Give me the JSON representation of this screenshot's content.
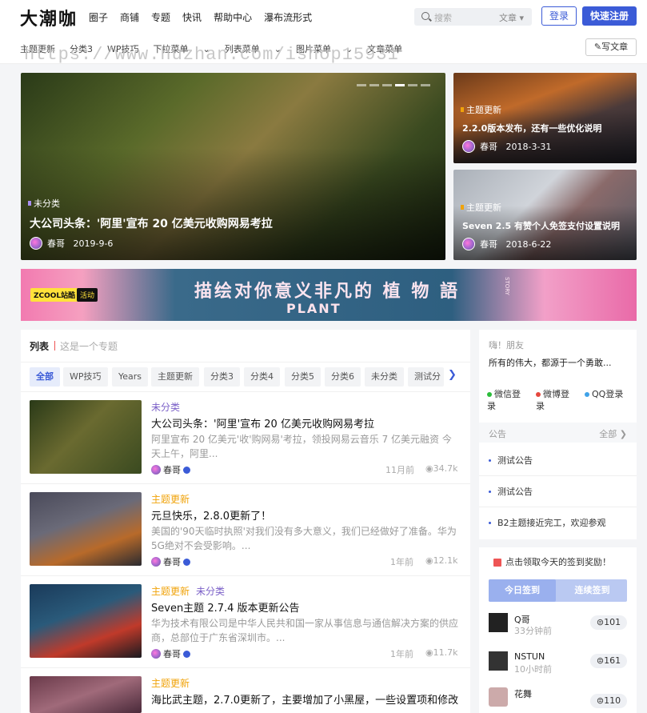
{
  "header": {
    "logo": "大潮咖",
    "nav": [
      "圈子",
      "商铺",
      "专题",
      "快讯",
      "帮助中心",
      "瀑布流形式"
    ],
    "search_placeholder": "搜索",
    "search_category": "文章",
    "login": "登录",
    "register": "快速注册",
    "subnav": [
      "主题更新",
      "分类3",
      "WP技巧",
      "下拉菜单",
      "列表菜单",
      "图片菜单",
      "文章菜单"
    ],
    "write": "写文章"
  },
  "watermark": "https://www.huzhan.com/ishop15931",
  "slides": [
    {
      "tag": "未分类",
      "title": "大公司头条：'阿里'宣布 20 亿美元收购网易考拉",
      "author": "春哥",
      "date": "2019-9-6"
    },
    {
      "tag": "主题更新",
      "title": "2.2.0版本发布，还有一些优化说明",
      "author": "春哥",
      "date": "2018-3-31"
    },
    {
      "tag": "主题更新",
      "title": "Seven 2.5 有赞个人免签支付设置说明",
      "author": "春哥",
      "date": "2018-6-22"
    }
  ],
  "banner": {
    "brand": "ZCOOL站酷",
    "label": "活动",
    "text": "描绘对你意义非凡的 植 物 語",
    "plant": "PLANT",
    "story": "STORY"
  },
  "list": {
    "title": "列表",
    "subtitle": "这是一个专题",
    "tabs": [
      "全部",
      "WP技巧",
      "Years",
      "主题更新",
      "分类3",
      "分类4",
      "分类5",
      "分类6",
      "未分类",
      "测试分"
    ],
    "items": [
      {
        "cats": [
          "未分类"
        ],
        "title": "大公司头条：'阿里'宣布 20 亿美元收购网易考拉",
        "desc": "阿里宣布 20 亿美元'收'购网易'考拉，领投网易云音乐 7 亿美元融资 今天上午，阿里...",
        "author": "春哥",
        "time": "11月前",
        "views": "34.7k"
      },
      {
        "cats": [
          "主题更新"
        ],
        "title": "元旦快乐，2.8.0更新了！",
        "desc": "美国的'90天临时执照'对我们没有多大意义，我们已经做好了准备。华为5G绝对不会受影响。...",
        "author": "春哥",
        "time": "1年前",
        "views": "12.1k"
      },
      {
        "cats": [
          "主题更新",
          "未分类"
        ],
        "title": "Seven主题 2.7.4 版本更新公告",
        "desc": "华为技术有限公司是中华人民共和国一家从事信息与通信解决方案的供应商，总部位于广东省深圳市。...",
        "author": "春哥",
        "time": "1年前",
        "views": "11.7k"
      },
      {
        "cats": [
          "主题更新"
        ],
        "title": "海比武主题，2.7.0更新了，主要增加了小黑屋，一些设置项和修改",
        "desc": "",
        "author": "",
        "time": "",
        "views": ""
      }
    ]
  },
  "sidebar": {
    "hi": "嗨！朋友",
    "motto": "所有的伟大，都源于一个勇敢...",
    "social": [
      "微信登录",
      "微博登录",
      "QQ登录"
    ],
    "notice_title": "公告",
    "notice_all": "全部",
    "notices": [
      "测试公告",
      "测试公告",
      "B2主题接近完工，欢迎参观"
    ],
    "sign_title": "点击领取今天的签到奖励！",
    "sign_tabs": [
      "今日签到",
      "连续签到"
    ],
    "users": [
      {
        "name": "Q哥",
        "time": "33分钟前",
        "count": "101"
      },
      {
        "name": "NSTUN",
        "time": "10小时前",
        "count": "161"
      },
      {
        "name": "花舞",
        "time": "",
        "count": "110"
      }
    ]
  },
  "colors": {
    "accent": "#3b5bd7",
    "orange": "#f0a30a",
    "purple": "#7a5fc7"
  }
}
